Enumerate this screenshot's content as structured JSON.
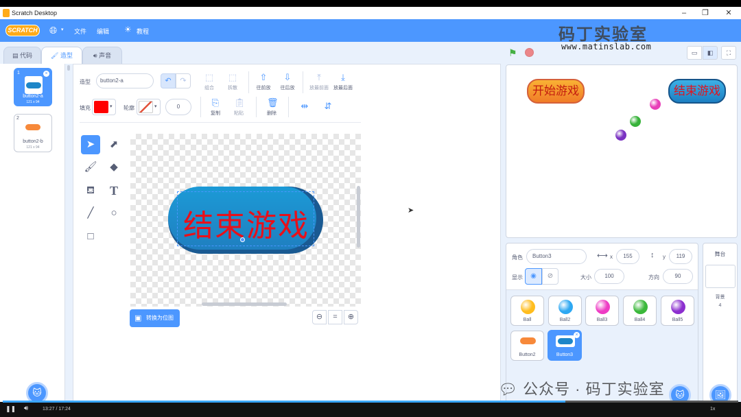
{
  "window": {
    "title": "Scratch Desktop"
  },
  "menubar": {
    "logo": "SCRATCH",
    "file": "文件",
    "edit": "编辑",
    "tutorials": "教程"
  },
  "watermark": {
    "title": "码丁实验室",
    "url": "www.matinslab.com"
  },
  "tabs": [
    {
      "label": "代码"
    },
    {
      "label": "造型"
    },
    {
      "label": "声音"
    }
  ],
  "costumes": [
    {
      "num": "1",
      "name": "button2-a",
      "size": "121 x 94",
      "color": "#1e86c8"
    },
    {
      "num": "2",
      "name": "button2-b",
      "size": "121 x 94",
      "color": "#f7893a"
    }
  ],
  "editor": {
    "costume_label": "造型",
    "costume_name": "button2-a",
    "fill_label": "填充",
    "outline_label": "轮廓",
    "outline_width": "0",
    "fill_color": "#ff0000",
    "group": "组合",
    "ungroup": "拆散",
    "forward": "往前放",
    "backward": "往后放",
    "front": "放最前面",
    "back": "放最后面",
    "copy": "复制",
    "paste": "粘贴",
    "delete": "删除",
    "convert_bitmap": "转换为位图",
    "zoom_equal": "="
  },
  "canvas_button": {
    "text": "结束游戏",
    "bg": "#1c9ad6",
    "text_color": "#e8101a"
  },
  "stage": {
    "start_button": "开始游戏",
    "end_button": "结束游戏",
    "balls": [
      {
        "color": "#e83fb8"
      },
      {
        "color": "#37b23a"
      },
      {
        "color": "#7a32c2"
      }
    ]
  },
  "sprite_info": {
    "sprite_label": "角色",
    "sprite_name": "Button3",
    "x_label": "x",
    "x": "155",
    "y_label": "y",
    "y": "119",
    "show_label": "显示",
    "size_label": "大小",
    "size": "100",
    "direction_label": "方向",
    "direction": "90"
  },
  "sprites": [
    {
      "name": "Ball",
      "color": "#ffbd1e"
    },
    {
      "name": "Ball2",
      "color": "#2ea8f2"
    },
    {
      "name": "Ball3",
      "color": "#ee3cc4"
    },
    {
      "name": "Ball4",
      "color": "#3bb83b"
    },
    {
      "name": "Ball5",
      "color": "#8c2fcf"
    },
    {
      "name": "Button2",
      "color": "#f7893a"
    },
    {
      "name": "Button3",
      "color": "#1e86c8"
    }
  ],
  "stage_pane": {
    "title": "舞台",
    "backdrops_label": "背景",
    "backdrops_count": "4"
  },
  "video": {
    "time": "13:27 / 17:24",
    "speed": "1x",
    "progress": 0.765
  },
  "wechat_watermark": "公众号 · 码丁实验室"
}
